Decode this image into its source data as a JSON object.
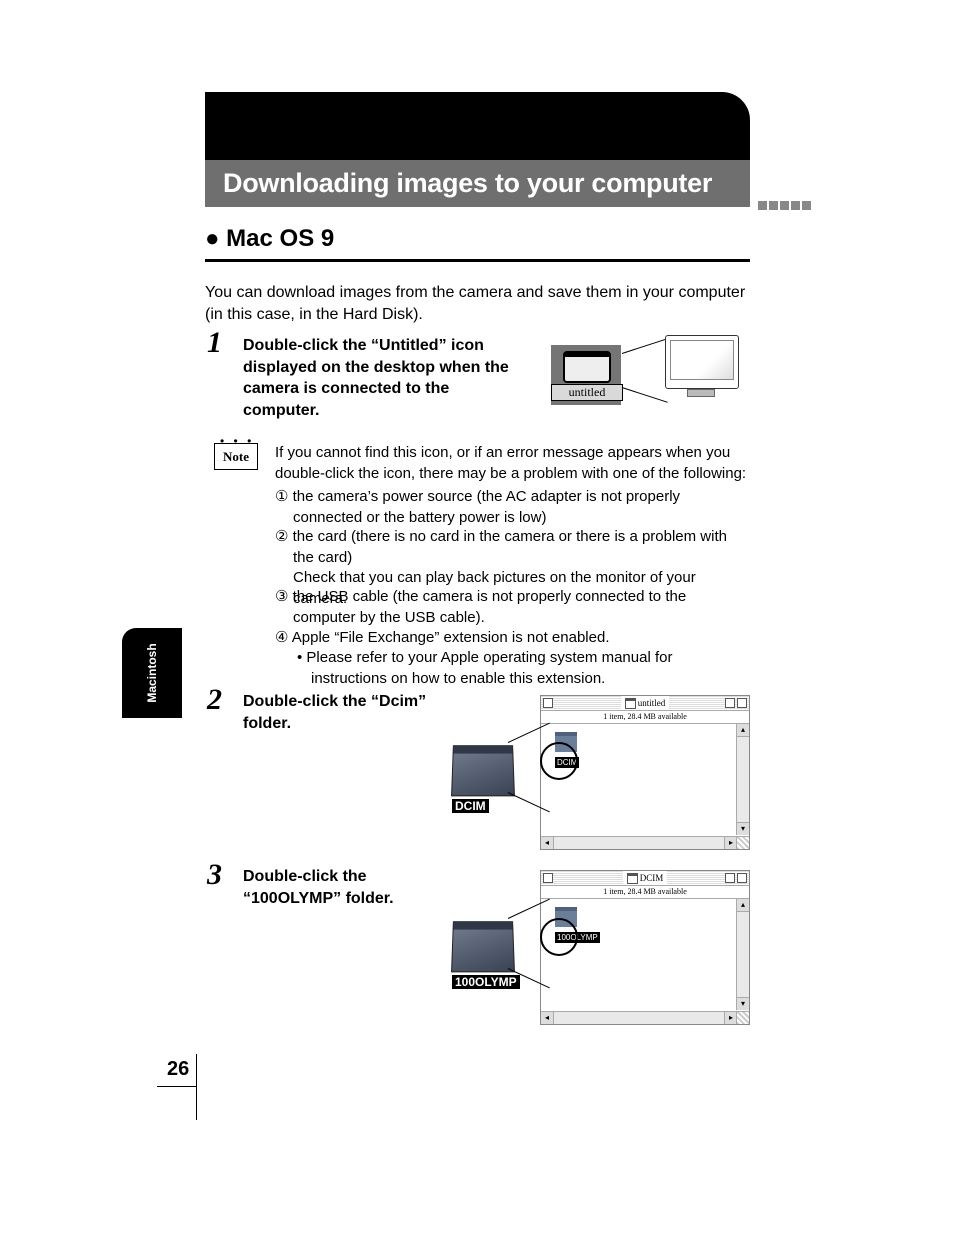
{
  "header": {
    "title": "Downloading images to your computer"
  },
  "subheading": "Mac OS 9",
  "intro": "You can download images from the camera and save them in your computer (in this case, in the Hard Disk).",
  "step1": {
    "num": "1",
    "text": "Double-click the “Untitled” icon displayed on the desktop when the camera is connected to the computer.",
    "icon_label": "untitled"
  },
  "note": {
    "label": "Note",
    "text": "If you cannot find this icon, or if an error message appears when you double-click the icon, there may be a problem with one of the following:",
    "items": [
      "① the camera’s power source (the AC adapter is not properly connected or the battery power is low)",
      "② the card (there is no card in the camera or there is a problem with the card)",
      "Check that you can play back pictures on the monitor of your camera.",
      "③ the USB cable (the camera is not properly connected to the computer by the USB cable).",
      "④ Apple “File Exchange” extension is not enabled.",
      "•  Please refer to your Apple operating system manual for instructions on how to enable this extension."
    ]
  },
  "step2": {
    "num": "2",
    "text": "Double-click the “Dcim” folder.",
    "window_title": "untitled",
    "window_sub": "1 item, 28.4 MB available",
    "win_icon_label": "DCIM",
    "callout_label": "DCIM"
  },
  "step3": {
    "num": "3",
    "text": "Double-click the “100OLYMP” folder.",
    "window_title": "DCIM",
    "window_sub": "1 item, 28.4 MB available",
    "win_icon_label": "100OLYMP",
    "callout_label": "100OLYMP"
  },
  "sidebar": "Macintosh",
  "page_number": "26"
}
